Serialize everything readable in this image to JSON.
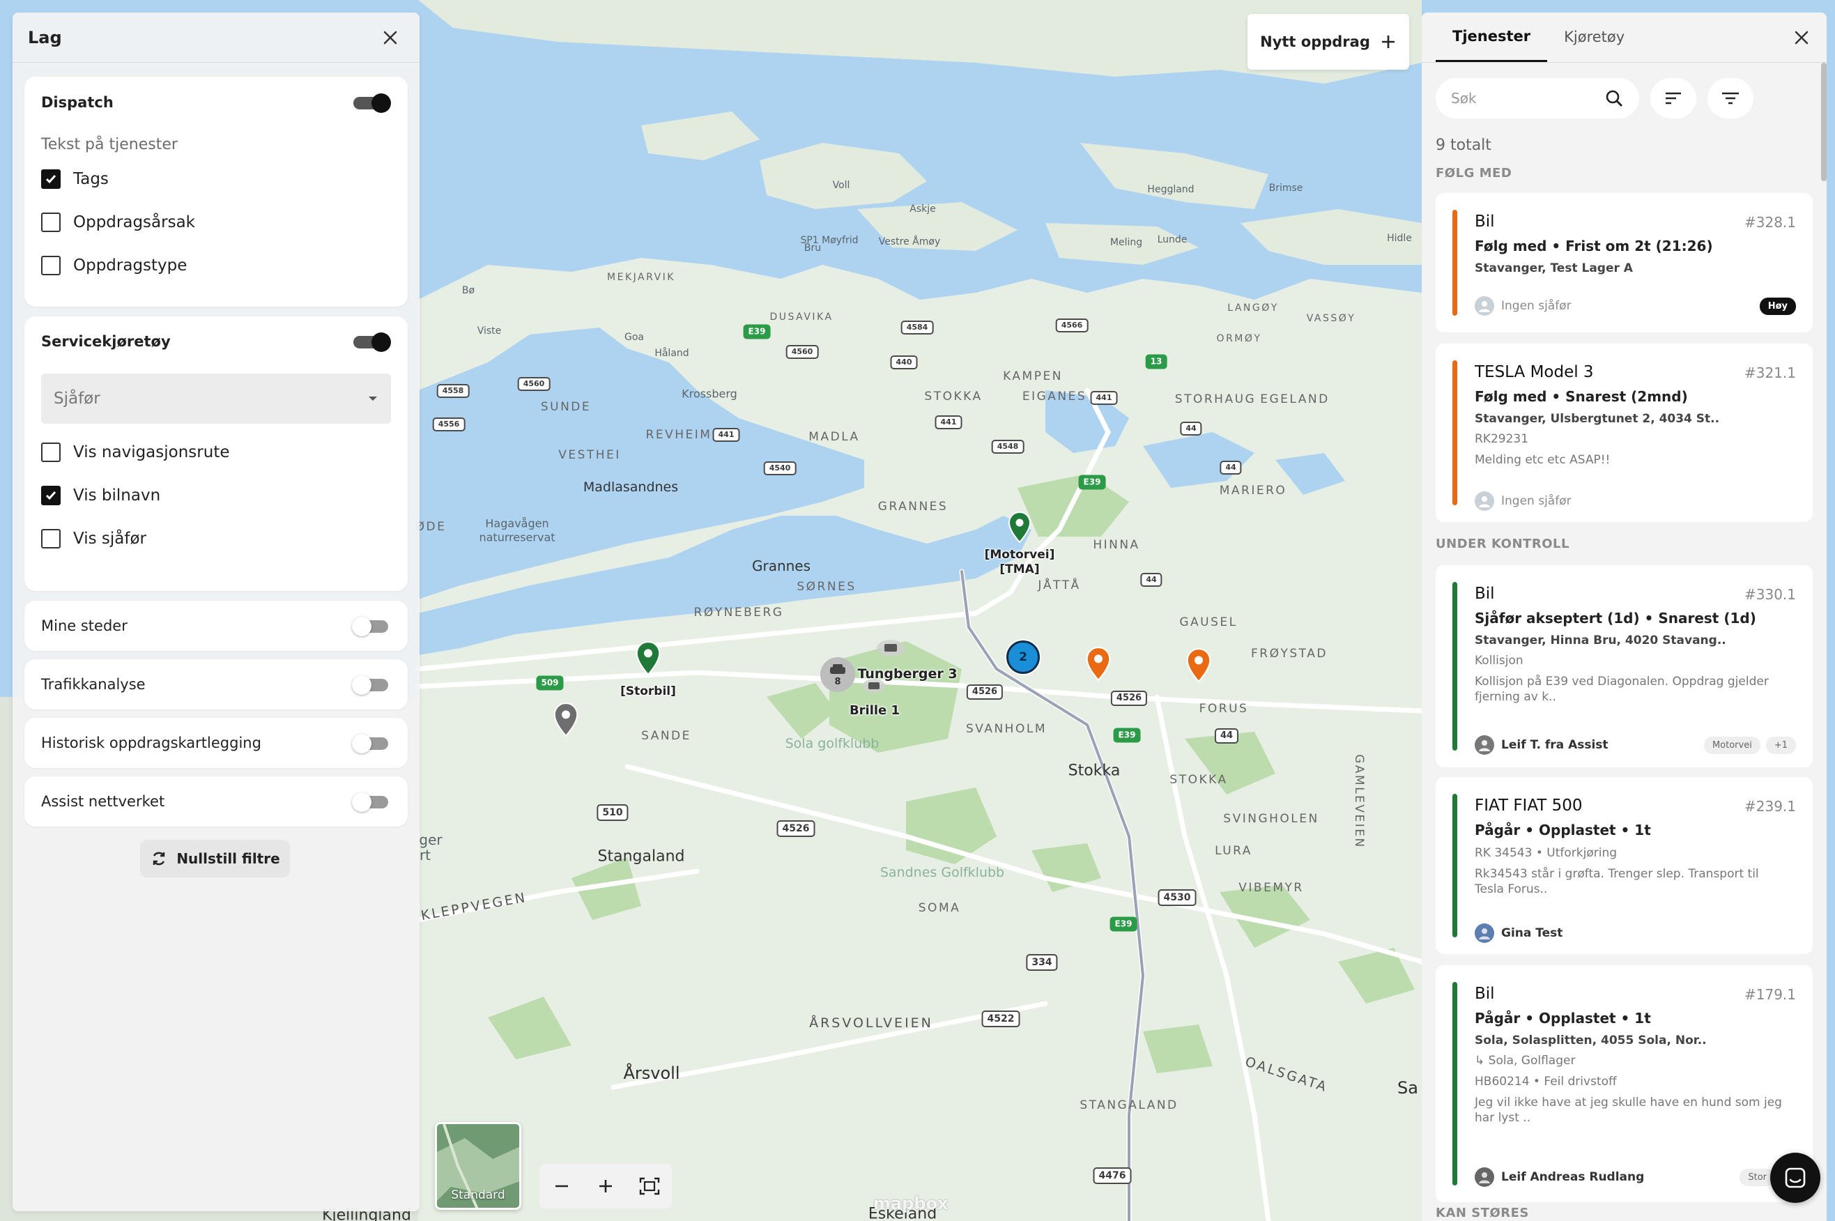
{
  "left_panel": {
    "title": "Lag",
    "dispatch": {
      "title": "Dispatch",
      "enabled": true,
      "subheading": "Tekst på tjenester",
      "options": [
        {
          "label": "Tags",
          "checked": true
        },
        {
          "label": "Oppdragsårsak",
          "checked": false
        },
        {
          "label": "Oppdragstype",
          "checked": false
        }
      ]
    },
    "service_vehicles": {
      "title": "Servicekjøretøy",
      "enabled": true,
      "select_placeholder": "Sjåfør",
      "options": [
        {
          "label": "Vis navigasjonsrute",
          "checked": false
        },
        {
          "label": "Vis bilnavn",
          "checked": true
        },
        {
          "label": "Vis sjåfør",
          "checked": false
        }
      ]
    },
    "layers": [
      {
        "title": "Mine steder",
        "enabled": false
      },
      {
        "title": "Trafikkanalyse",
        "enabled": false
      },
      {
        "title": "Historisk oppdragskartlegging",
        "enabled": false
      },
      {
        "title": "Assist nettverket",
        "enabled": false
      }
    ],
    "reset_label": "Nullstill filtre"
  },
  "map": {
    "new_job_label": "Nytt oppdrag",
    "style_label": "Standard",
    "attribution": "mapbox",
    "labels": {
      "voll": "Voll",
      "askje": "Askje",
      "heggland": "Heggland",
      "brimse": "Brimse",
      "sp1": "SP1 Møyfrid",
      "bru": "Bru",
      "vestre_amoy": "Vestre Åmøy",
      "meling": "Meling",
      "lunde": "Lunde",
      "hidle": "Hidle",
      "mekjarvik": "MEKJARVIK",
      "bo": "Bø",
      "dusavika": "DUSAVIKA",
      "langoy": "LANGØY",
      "vassoy": "VASSØY",
      "viste": "Viste",
      "goa": "Goa",
      "haland": "Håland",
      "ormoy": "ORMØY",
      "kampen": "KAMPEN",
      "sunde": "SUNDE",
      "krossberg": "Krossberg",
      "stokka_n": "STOKKA",
      "eiganes": "EIGANES",
      "storhaug": "STORHAUG",
      "egeland": "EGELAND",
      "revheim": "REVHEIM",
      "madla": "MADLA",
      "vesthei": "VESTHEI",
      "madlasandnes": "Madlasandnes",
      "mariero": "MARIERO",
      "hagavagen": "Hagavågen",
      "naturreservat": "naturreservat",
      "ode": "ØDE",
      "grannes_u": "GRANNES",
      "hinna": "HINNA",
      "grannes": "Grannes",
      "jatta": "JÅTTÅ",
      "sornes": "SØRNES",
      "royneberg": "RØYNEBERG",
      "gausel": "GAUSEL",
      "froystad": "FRØYSTAD",
      "sola_golf": "Sola golfklubb",
      "sande": "SANDE",
      "svanholm": "SVANHOLM",
      "forus": "FORUS",
      "stokka": "Stokka",
      "stokka_u": "STOKKA",
      "gamleveien": "GAMLEVEIEN",
      "svingholen": "SVINGHOLEN",
      "lura": "LURA",
      "stangaland": "Stangaland",
      "sandnes_golf": "Sandnes Golfklubb",
      "vibemyr": "VIBEMYR",
      "kleppvegen": "KLEPPVEGEN",
      "soma": "SOMA",
      "arsvollveien": "ÅRSVOLLVEIEN",
      "arsvoll": "Årsvoll",
      "oalsgata": "OALSGATA",
      "stangaland_u": "STANGALAND",
      "sa": "Sa",
      "kjellingland": "Kjellingland",
      "eskeland": "Eskeland"
    },
    "roads": {
      "r4584": "4584",
      "e39a": "E39",
      "r4560a": "4560",
      "r440": "440",
      "r4566": "4566",
      "r13": "13",
      "r4558": "4558",
      "r4560b": "4560",
      "r4556": "4556",
      "r441a": "441",
      "r441b": "441",
      "r441c": "441",
      "r44a": "44",
      "r4548": "4548",
      "r4540": "4540",
      "r44b": "44",
      "e39b": "E39",
      "r44c": "44",
      "r509": "509",
      "r4526a": "4526",
      "r4526b": "4526",
      "e39c": "E39",
      "r44d": "44",
      "r510": "510",
      "r4526c": "4526",
      "r4530": "4530",
      "e39d": "E39",
      "r334": "334",
      "r4522": "4522",
      "r4476": "4476",
      "ger": "ger",
      "rt": "rt"
    },
    "markers": {
      "motorvei": "[Motorvei]\n[TMA]",
      "storbil": "[Storbil]",
      "cluster_count": "2",
      "vehicle_group_count": "8",
      "tungberger": "Tungberger 3",
      "brille": "Brille 1"
    },
    "colors": {
      "water": "#aed3f0",
      "land": "#e7eee4",
      "green": "#bcdcae",
      "road": "#ffffff",
      "pin_green": "#1f7a37",
      "pin_orange": "#ea6a14",
      "pin_gray": "#6e6e6e",
      "cluster": "#1a8fd8"
    }
  },
  "right_panel": {
    "tabs": [
      {
        "label": "Tjenester",
        "active": true
      },
      {
        "label": "Kjøretøy",
        "active": false
      }
    ],
    "search_placeholder": "Søk",
    "total": "9 totalt",
    "groups": [
      {
        "heading": "FØLG MED"
      },
      {
        "heading": "UNDER KONTROLL"
      },
      {
        "heading": "KAN STØRES"
      }
    ],
    "jobs": [
      {
        "title": "Bil",
        "id": "#328.1",
        "status": "Følg med • Frist om 2t (21:26)",
        "address": "Stavanger, Test Lager A",
        "lines": [],
        "driver": "Ingen sjåfør",
        "driver_assigned": false,
        "tags": [
          "Høy"
        ],
        "stripe": "#ea6a14"
      },
      {
        "title": "TESLA Model 3",
        "id": "#321.1",
        "status": "Følg med • Snarest (2mnd)",
        "address": "Stavanger, Ulsbergtunet 2, 4034 St..",
        "lines": [
          "RK29231",
          "Melding etc etc ASAP!!"
        ],
        "driver": "Ingen sjåfør",
        "driver_assigned": false,
        "tags": [],
        "stripe": "#ea6a14"
      },
      {
        "title": "Bil",
        "id": "#330.1",
        "status": "Sjåfør akseptert (1d) • Snarest (1d)",
        "address": "Stavanger, Hinna Bru, 4020 Stavang..",
        "lines": [
          "Kollisjon",
          "Kollisjon på E39 ved Diagonalen. Oppdrag gjelder fjerning av k.."
        ],
        "driver": "Leif T. fra Assist",
        "driver_assigned": true,
        "tags": [
          "Motorvei",
          "+1"
        ],
        "stripe": "#1f7a37"
      },
      {
        "title": "FIAT FIAT 500",
        "id": "#239.1",
        "status": "Pågår • Opplastet • 1t",
        "address": "RK 34543 • Utforkjøring",
        "lines": [
          "Rk34543 står i grøfta. Trenger slep. Transport til Tesla Forus.."
        ],
        "driver": "Gina Test",
        "driver_assigned": true,
        "tags": [],
        "stripe": "#1f7a37"
      },
      {
        "title": "Bil",
        "id": "#179.1",
        "status": "Pågår • Opplastet • 1t",
        "address": "Sola, Solasplitten, 4055 Sola, Nor..",
        "lines": [
          "↳ Sola, Golflager",
          "HB60214 • Feil drivstoff",
          "Jeg vil ikke have at jeg skulle have en hund som jeg har lyst .."
        ],
        "driver": "Leif Andreas Rudlang",
        "driver_assigned": true,
        "tags": [
          "Stor"
        ],
        "stripe": "#1f7a37"
      }
    ]
  }
}
